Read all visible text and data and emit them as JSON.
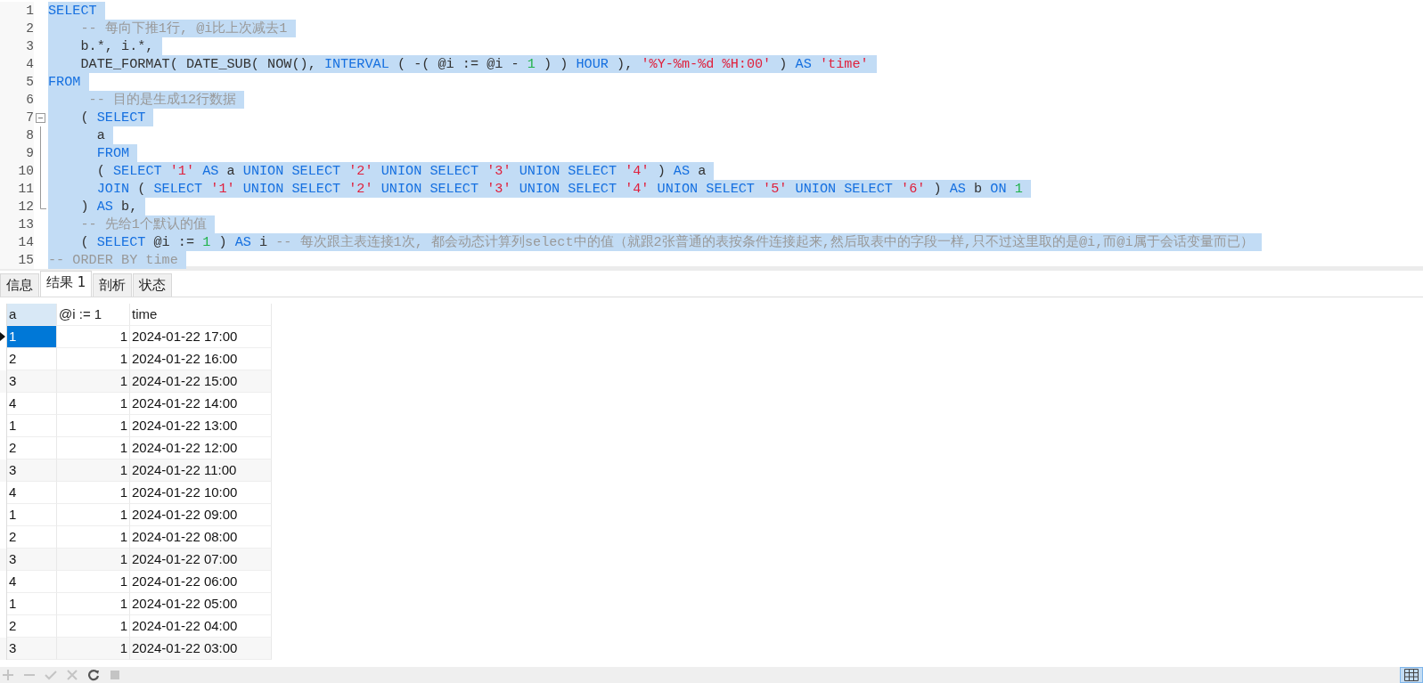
{
  "editor": {
    "lines": [
      {
        "number": "1",
        "selected": true,
        "segments": [
          {
            "kind": "keyword",
            "text": "SELECT"
          }
        ]
      },
      {
        "number": "2",
        "selected": true,
        "segments": [
          {
            "kind": "comment",
            "text": "    -- 每向下推1行, @i比上次减去1"
          }
        ]
      },
      {
        "number": "3",
        "selected": true,
        "segments": [
          {
            "kind": "plain",
            "text": "    b.*, i.*,"
          }
        ]
      },
      {
        "number": "4",
        "selected": true,
        "segments": [
          {
            "kind": "plain",
            "text": "    DATE_FORMAT( DATE_SUB( NOW(), "
          },
          {
            "kind": "keyword",
            "text": "INTERVAL"
          },
          {
            "kind": "plain",
            "text": " ( -( @i := @i - "
          },
          {
            "kind": "number",
            "text": "1"
          },
          {
            "kind": "plain",
            "text": " ) ) "
          },
          {
            "kind": "keyword",
            "text": "HOUR"
          },
          {
            "kind": "plain",
            "text": " ), "
          },
          {
            "kind": "string",
            "text": "'%Y-%m-%d %H:00'"
          },
          {
            "kind": "plain",
            "text": " ) "
          },
          {
            "kind": "keyword",
            "text": "AS"
          },
          {
            "kind": "string",
            "text": " 'time'"
          }
        ]
      },
      {
        "number": "5",
        "selected": true,
        "segments": [
          {
            "kind": "keyword",
            "text": "FROM"
          }
        ]
      },
      {
        "number": "6",
        "selected": true,
        "segments": [
          {
            "kind": "comment",
            "text": "     -- 目的是生成12行数据"
          }
        ]
      },
      {
        "number": "7",
        "selected": true,
        "expanded": true,
        "segments": [
          {
            "kind": "plain",
            "text": "    ( "
          },
          {
            "kind": "keyword",
            "text": "SELECT"
          }
        ]
      },
      {
        "number": "8",
        "selected": true,
        "segments": [
          {
            "kind": "plain",
            "text": "      a"
          }
        ]
      },
      {
        "number": "9",
        "selected": true,
        "segments": [
          {
            "kind": "keyword",
            "text": "      FROM"
          }
        ]
      },
      {
        "number": "10",
        "selected": true,
        "segments": [
          {
            "kind": "plain",
            "text": "      ( "
          },
          {
            "kind": "keyword",
            "text": "SELECT"
          },
          {
            "kind": "string",
            "text": " '1'"
          },
          {
            "kind": "keyword",
            "text": " AS"
          },
          {
            "kind": "plain",
            "text": " a "
          },
          {
            "kind": "keyword",
            "text": "UNION SELECT"
          },
          {
            "kind": "string",
            "text": " '2'"
          },
          {
            "kind": "keyword",
            "text": " UNION SELECT"
          },
          {
            "kind": "string",
            "text": " '3'"
          },
          {
            "kind": "keyword",
            "text": " UNION SELECT"
          },
          {
            "kind": "string",
            "text": " '4'"
          },
          {
            "kind": "plain",
            "text": " ) "
          },
          {
            "kind": "keyword",
            "text": "AS"
          },
          {
            "kind": "plain",
            "text": " a"
          }
        ]
      },
      {
        "number": "11",
        "selected": true,
        "segments": [
          {
            "kind": "keyword",
            "text": "      JOIN"
          },
          {
            "kind": "plain",
            "text": " ( "
          },
          {
            "kind": "keyword",
            "text": "SELECT"
          },
          {
            "kind": "string",
            "text": " '1'"
          },
          {
            "kind": "keyword",
            "text": " UNION SELECT"
          },
          {
            "kind": "string",
            "text": " '2'"
          },
          {
            "kind": "keyword",
            "text": " UNION SELECT"
          },
          {
            "kind": "string",
            "text": " '3'"
          },
          {
            "kind": "keyword",
            "text": " UNION SELECT"
          },
          {
            "kind": "string",
            "text": " '4'"
          },
          {
            "kind": "keyword",
            "text": " UNION SELECT"
          },
          {
            "kind": "string",
            "text": " '5'"
          },
          {
            "kind": "keyword",
            "text": " UNION SELECT"
          },
          {
            "kind": "string",
            "text": " '6'"
          },
          {
            "kind": "plain",
            "text": " ) "
          },
          {
            "kind": "keyword",
            "text": "AS"
          },
          {
            "kind": "plain",
            "text": " b "
          },
          {
            "kind": "keyword",
            "text": "ON"
          },
          {
            "kind": "number",
            "text": " 1"
          }
        ]
      },
      {
        "number": "12",
        "selected": true,
        "fold_end": true,
        "segments": [
          {
            "kind": "plain",
            "text": "    ) "
          },
          {
            "kind": "keyword",
            "text": "AS"
          },
          {
            "kind": "plain",
            "text": " b,"
          }
        ]
      },
      {
        "number": "13",
        "selected": true,
        "segments": [
          {
            "kind": "comment",
            "text": "    -- 先给1个默认的值"
          }
        ]
      },
      {
        "number": "14",
        "selected": true,
        "segments": [
          {
            "kind": "plain",
            "text": "    ( "
          },
          {
            "kind": "keyword",
            "text": "SELECT"
          },
          {
            "kind": "plain",
            "text": " @i := "
          },
          {
            "kind": "number",
            "text": "1"
          },
          {
            "kind": "plain",
            "text": " ) "
          },
          {
            "kind": "keyword",
            "text": "AS"
          },
          {
            "kind": "plain",
            "text": " i "
          },
          {
            "kind": "comment",
            "text": "-- 每次跟主表连接1次, 都会动态计算列select中的值（就跟2张普通的表按条件连接起来,然后取表中的字段一样,只不过这里取的是@i,而@i属于会话变量而已）"
          }
        ]
      },
      {
        "number": "15",
        "selected": true,
        "segments": [
          {
            "kind": "comment",
            "text": "-- ORDER BY time"
          }
        ]
      }
    ]
  },
  "tabs": [
    {
      "label": "信息",
      "selected": false
    },
    {
      "label": "结果 1",
      "selected": true
    },
    {
      "label": "剖析",
      "selected": false
    },
    {
      "label": "状态",
      "selected": false
    }
  ],
  "grid": {
    "columns": [
      {
        "label": "a",
        "selected": true
      },
      {
        "label": "@i := 1",
        "selected": false
      },
      {
        "label": "time",
        "selected": false
      }
    ],
    "rows": [
      {
        "current": true,
        "cells": [
          {
            "text": "1",
            "selected": true
          },
          {
            "text": "1",
            "selected": false
          },
          {
            "text": "2024-01-22 17:00",
            "selected": false
          }
        ]
      },
      {
        "current": false,
        "cells": [
          {
            "text": "2",
            "selected": false
          },
          {
            "text": "1",
            "selected": false
          },
          {
            "text": "2024-01-22 16:00",
            "selected": false
          }
        ]
      },
      {
        "current": false,
        "cells": [
          {
            "text": "3",
            "selected": false
          },
          {
            "text": "1",
            "selected": false
          },
          {
            "text": "2024-01-22 15:00",
            "selected": false
          }
        ]
      },
      {
        "current": false,
        "cells": [
          {
            "text": "4",
            "selected": false
          },
          {
            "text": "1",
            "selected": false
          },
          {
            "text": "2024-01-22 14:00",
            "selected": false
          }
        ]
      },
      {
        "current": false,
        "cells": [
          {
            "text": "1",
            "selected": false
          },
          {
            "text": "1",
            "selected": false
          },
          {
            "text": "2024-01-22 13:00",
            "selected": false
          }
        ]
      },
      {
        "current": false,
        "cells": [
          {
            "text": "2",
            "selected": false
          },
          {
            "text": "1",
            "selected": false
          },
          {
            "text": "2024-01-22 12:00",
            "selected": false
          }
        ]
      },
      {
        "current": false,
        "cells": [
          {
            "text": "3",
            "selected": false
          },
          {
            "text": "1",
            "selected": false
          },
          {
            "text": "2024-01-22 11:00",
            "selected": false
          }
        ]
      },
      {
        "current": false,
        "cells": [
          {
            "text": "4",
            "selected": false
          },
          {
            "text": "1",
            "selected": false
          },
          {
            "text": "2024-01-22 10:00",
            "selected": false
          }
        ]
      },
      {
        "current": false,
        "cells": [
          {
            "text": "1",
            "selected": false
          },
          {
            "text": "1",
            "selected": false
          },
          {
            "text": "2024-01-22 09:00",
            "selected": false
          }
        ]
      },
      {
        "current": false,
        "cells": [
          {
            "text": "2",
            "selected": false
          },
          {
            "text": "1",
            "selected": false
          },
          {
            "text": "2024-01-22 08:00",
            "selected": false
          }
        ]
      },
      {
        "current": false,
        "cells": [
          {
            "text": "3",
            "selected": false
          },
          {
            "text": "1",
            "selected": false
          },
          {
            "text": "2024-01-22 07:00",
            "selected": false
          }
        ]
      },
      {
        "current": false,
        "cells": [
          {
            "text": "4",
            "selected": false
          },
          {
            "text": "1",
            "selected": false
          },
          {
            "text": "2024-01-22 06:00",
            "selected": false
          }
        ]
      },
      {
        "current": false,
        "cells": [
          {
            "text": "1",
            "selected": false
          },
          {
            "text": "1",
            "selected": false
          },
          {
            "text": "2024-01-22 05:00",
            "selected": false
          }
        ]
      },
      {
        "current": false,
        "cells": [
          {
            "text": "2",
            "selected": false
          },
          {
            "text": "1",
            "selected": false
          },
          {
            "text": "2024-01-22 04:00",
            "selected": false
          }
        ]
      },
      {
        "current": false,
        "cells": [
          {
            "text": "3",
            "selected": false
          },
          {
            "text": "1",
            "selected": false
          },
          {
            "text": "2024-01-22 03:00",
            "selected": false
          }
        ]
      }
    ]
  },
  "toolbar": {
    "buttons": [
      {
        "kind": "add",
        "disabled": true
      },
      {
        "kind": "remove",
        "disabled": true
      },
      {
        "kind": "apply",
        "disabled": true
      },
      {
        "kind": "discard",
        "disabled": true
      },
      {
        "kind": "refresh",
        "disabled": false
      },
      {
        "kind": "stop",
        "disabled": true
      }
    ],
    "grid_view": {
      "selected": true
    }
  }
}
